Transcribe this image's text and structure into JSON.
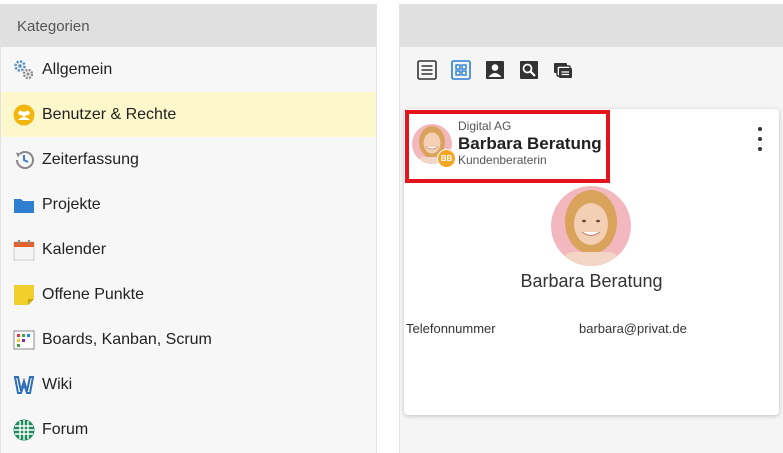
{
  "categories": {
    "header": "Kategorien",
    "items": [
      {
        "label": "Allgemein",
        "icon": "gears-icon"
      },
      {
        "label": "Benutzer & Rechte",
        "icon": "users-icon",
        "selected": true
      },
      {
        "label": "Zeiterfassung",
        "icon": "clock-history-icon"
      },
      {
        "label": "Projekte",
        "icon": "folder-icon"
      },
      {
        "label": "Kalender",
        "icon": "calendar-icon"
      },
      {
        "label": "Offene Punkte",
        "icon": "sticky-note-icon"
      },
      {
        "label": "Boards, Kanban, Scrum",
        "icon": "board-icon"
      },
      {
        "label": "Wiki",
        "icon": "wiki-icon"
      },
      {
        "label": "Forum",
        "icon": "forum-icon"
      }
    ]
  },
  "toolbar": {
    "buttons": [
      "list-view-icon",
      "grid-view-icon",
      "person-view-icon",
      "search-icon",
      "cards-view-icon"
    ]
  },
  "card": {
    "company": "Digital AG",
    "name": "Barbara Beratung",
    "role": "Kundenberaterin",
    "badge": "BB",
    "display_name": "Barbara Beratung",
    "phone_label": "Telefonnummer",
    "email": "barbara@privat.de"
  },
  "colors": {
    "selected_row": "#fdf7cc",
    "header_bg": "#e0e0e0",
    "highlight_border": "#e3141b",
    "badge": "#f5a623",
    "avatar_bg": "#f2b8bd"
  }
}
